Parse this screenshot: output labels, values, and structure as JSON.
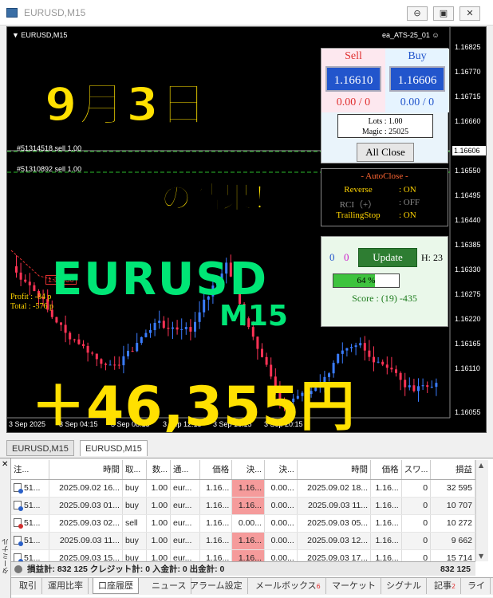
{
  "window": {
    "title": "EURUSD,M15",
    "minimize": "⊖",
    "restore": "▣",
    "close": "✕"
  },
  "chart": {
    "symbol_label": "EURUSD,M15",
    "ea_label": "ea_ATS-25_01",
    "order_line_1": "#51314518 sell 1.00",
    "order_line_2": "#51310892 sell 1.00",
    "profit_line": "Profit : -84 p",
    "total_line": "Total : -576 p",
    "marker_label": "1.16536",
    "current_price": "1.16606",
    "price_ticks": [
      "1.16825",
      "1.16770",
      "1.16715",
      "1.16660",
      "1.16550",
      "1.16495",
      "1.16440",
      "1.16385",
      "1.16330",
      "1.16275",
      "1.16220",
      "1.16165",
      "1.16110",
      "1.16055"
    ],
    "time_ticks": [
      "3 Sep 2025",
      "3 Sep 04:15",
      "3 Sep 08:15",
      "3 Sep 12:15",
      "3 Sep 16:15",
      "3 Sep 20:15"
    ]
  },
  "captions": {
    "date": "9月3日",
    "result": "の結果！",
    "pair": "EURUSD",
    "timeframe": "M15",
    "profit": "＋46,355円"
  },
  "ea_panel": {
    "sell_label": "Sell",
    "buy_label": "Buy",
    "sell_price": "1.16610",
    "buy_price": "1.16606",
    "sell_pnl": "0.00 / 0",
    "buy_pnl": "0.00 / 0",
    "lots": "Lots   : 1.00",
    "magic": "Magic : 25025",
    "all_close": "All Close",
    "sell_color": "#e03030",
    "buy_color": "#2255cc"
  },
  "autoclose": {
    "title": "- AutoClose -",
    "rows": [
      {
        "key": "Reverse",
        "value": ": ON",
        "color": "#ffd400"
      },
      {
        "key": "RCI（+）",
        "value": ": OFF",
        "color": "#8a8a8a"
      },
      {
        "key": "TrailingStop",
        "value": ": ON",
        "color": "#ffd400"
      }
    ]
  },
  "score_panel": {
    "count_a": "0",
    "count_b": "0",
    "update_label": "Update",
    "hour_label": "H: 23",
    "progress_text": "64 %",
    "progress_value": 64,
    "score_text": "Score : (19) -435"
  },
  "chart_tabs": [
    "EURUSD,M15",
    "EURUSD,M15"
  ],
  "terminal": {
    "side_label": "ターミナル",
    "close_icon": "✕",
    "columns": [
      "注...",
      "時間",
      "取...",
      "数...",
      "通...",
      "価格",
      "決...",
      "決...",
      "時間",
      "価格",
      "スワ...",
      "損益"
    ],
    "rows": [
      {
        "ticket": "51...",
        "open_time": "2025.09.02 16...",
        "type": "buy",
        "volume": "1.00",
        "symbol": "eur...",
        "open_price": "1.16...",
        "sl": "1.16...",
        "tp": "0.00...",
        "close_time": "2025.09.02 18...",
        "close_price": "1.16...",
        "swap": "0",
        "profit": "32 595"
      },
      {
        "ticket": "51...",
        "open_time": "2025.09.03 01...",
        "type": "buy",
        "volume": "1.00",
        "symbol": "eur...",
        "open_price": "1.16...",
        "sl": "1.16...",
        "tp": "0.00...",
        "close_time": "2025.09.03 11...",
        "close_price": "1.16...",
        "swap": "0",
        "profit": "10 707"
      },
      {
        "ticket": "51...",
        "open_time": "2025.09.03 02...",
        "type": "sell",
        "volume": "1.00",
        "symbol": "eur...",
        "open_price": "1.16...",
        "sl": "0.00...",
        "tp": "0.00...",
        "close_time": "2025.09.03 05...",
        "close_price": "1.16...",
        "swap": "0",
        "profit": "10 272"
      },
      {
        "ticket": "51...",
        "open_time": "2025.09.03 11...",
        "type": "buy",
        "volume": "1.00",
        "symbol": "eur...",
        "open_price": "1.16...",
        "sl": "1.16...",
        "tp": "0.00...",
        "close_time": "2025.09.03 12...",
        "close_price": "1.16...",
        "swap": "0",
        "profit": "9 662"
      },
      {
        "ticket": "51...",
        "open_time": "2025.09.03 15...",
        "type": "buy",
        "volume": "1.00",
        "symbol": "eur...",
        "open_price": "1.16...",
        "sl": "1.16...",
        "tp": "0.00...",
        "close_time": "2025.09.03 17...",
        "close_price": "1.16...",
        "swap": "0",
        "profit": "15 714"
      }
    ],
    "summary": "損益計: 832 125  クレジット計: 0  入金計: 0  出金計: 0",
    "summary_total": "832 125",
    "tabs": [
      {
        "label": "取引",
        "badge": ""
      },
      {
        "label": "運用比率",
        "badge": ""
      },
      {
        "label": "口座履歴",
        "badge": ""
      },
      {
        "label": "ニュース",
        "badge": ""
      },
      {
        "label": "アラーム設定",
        "badge": ""
      },
      {
        "label": "メールボックス",
        "badge": "6"
      },
      {
        "label": "マーケット",
        "badge": ""
      },
      {
        "label": "シグナル",
        "badge": ""
      },
      {
        "label": "記事",
        "badge": "2"
      },
      {
        "label": "ライ",
        "badge": ""
      }
    ],
    "active_tab": 2
  }
}
